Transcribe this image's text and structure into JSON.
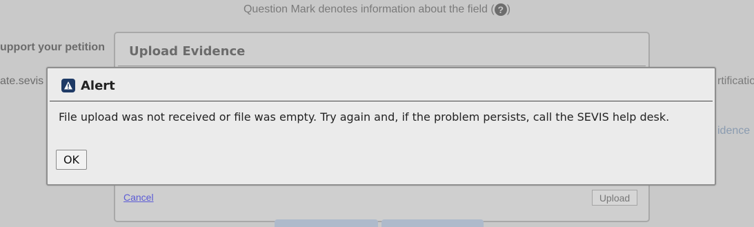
{
  "background": {
    "hint_text": "Question Mark denotes information about the field (",
    "hint_close": ")",
    "help_icon_glyph": "?",
    "left_text_1": "upport your petition",
    "left_text_2": "ate.sevis",
    "right_text_1": "rtificatio",
    "right_text_2": "idence"
  },
  "upload_dialog": {
    "title": "Upload Evidence",
    "cancel_label": "Cancel",
    "upload_label": "Upload"
  },
  "alert": {
    "title": "Alert",
    "icon": "alert-warning-icon",
    "message": "File upload was not received or file was empty. Try again and, if the problem persists, call the SEVIS help desk.",
    "ok_label": "OK"
  },
  "colors": {
    "overlay_background": "#c9c9c9",
    "alert_icon_bg": "#1e3a66",
    "link": "#5b5bd6"
  }
}
